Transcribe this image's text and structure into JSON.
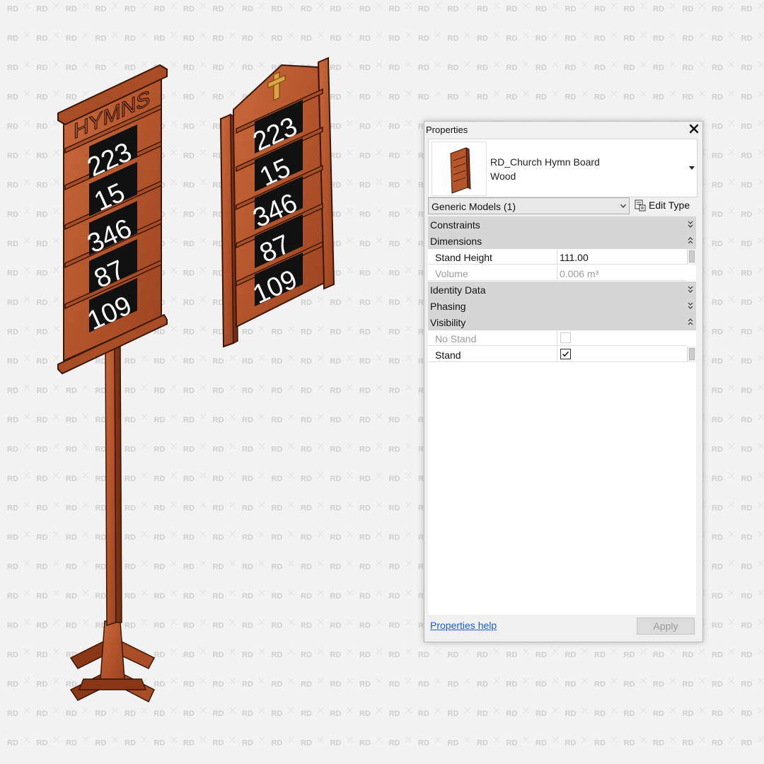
{
  "watermark": {
    "text": "RD"
  },
  "board_left": {
    "header": "HYMNS",
    "numbers": [
      "223",
      "15",
      "346",
      "87",
      "109"
    ]
  },
  "board_right": {
    "numbers": [
      "223",
      "15",
      "346",
      "87",
      "109"
    ]
  },
  "properties": {
    "title": "Properties",
    "type_name": "RD_Church Hymn Board",
    "type_material": "Wood",
    "filter": "Generic Models (1)",
    "edit_type": "Edit Type",
    "groups": {
      "constraints": "Constraints",
      "dimensions": "Dimensions",
      "identity_data": "Identity Data",
      "phasing": "Phasing",
      "visibility": "Visibility"
    },
    "params": {
      "stand_height": {
        "name": "Stand Height",
        "value": "111.00"
      },
      "volume": {
        "name": "Volume",
        "value": "0.006 m³"
      },
      "no_stand": {
        "name": "No Stand",
        "checked": false
      },
      "stand": {
        "name": "Stand",
        "checked": true
      }
    },
    "help": "Properties help",
    "apply": "Apply"
  },
  "colors": {
    "wood": "#b4552c",
    "wood_dark": "#7a2f12",
    "panel_black": "#111111",
    "link": "#1a5ec6"
  }
}
